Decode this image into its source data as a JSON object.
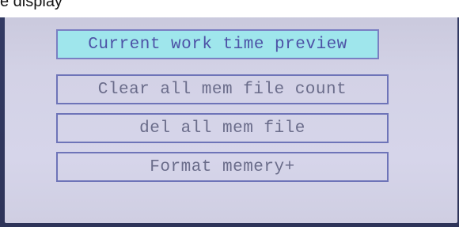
{
  "caption": "e display",
  "menu": {
    "items": [
      {
        "label": "Current work time preview",
        "selected": true
      },
      {
        "label": "Clear all mem file count",
        "selected": false
      },
      {
        "label": "del all mem file",
        "selected": false
      },
      {
        "label": "Format memery+",
        "selected": false
      }
    ]
  },
  "colors": {
    "screen_background": "#d3d2e6",
    "frame": "#2e3459",
    "item_border": "#6e74b8",
    "selected_background": "#9fe6ec",
    "selected_text": "#4d52a6",
    "item_text": "#6a6c8a"
  }
}
